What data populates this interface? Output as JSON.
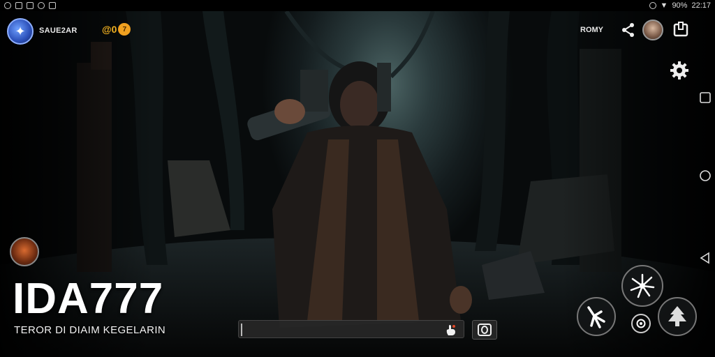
{
  "status_bar": {
    "battery": "90%",
    "time": "22:17"
  },
  "hud": {
    "brand": "SAUE2AR",
    "coins_text": "@0",
    "coins_badge": "7",
    "room_label": "ROMY"
  },
  "game": {
    "title": "IDA777",
    "subtitle": "TEROR DI DIAIM KEGELARIN"
  },
  "chat": {
    "placeholder": ""
  },
  "icons": {
    "logo": "game-logo-icon",
    "share": "share-icon",
    "exit": "exit-icon",
    "settings": "gear-icon",
    "nav_square": "recent-apps-icon",
    "nav_circle": "home-icon",
    "nav_back": "back-icon",
    "hand": "hand-icon",
    "camera": "camera-icon",
    "splash": "splash-attack-icon",
    "claw": "claw-attack-icon",
    "tree": "tree-icon",
    "target": "target-icon"
  },
  "colors": {
    "accent_coin": "#f0a020",
    "logo_blue": "#2b4fb8"
  }
}
